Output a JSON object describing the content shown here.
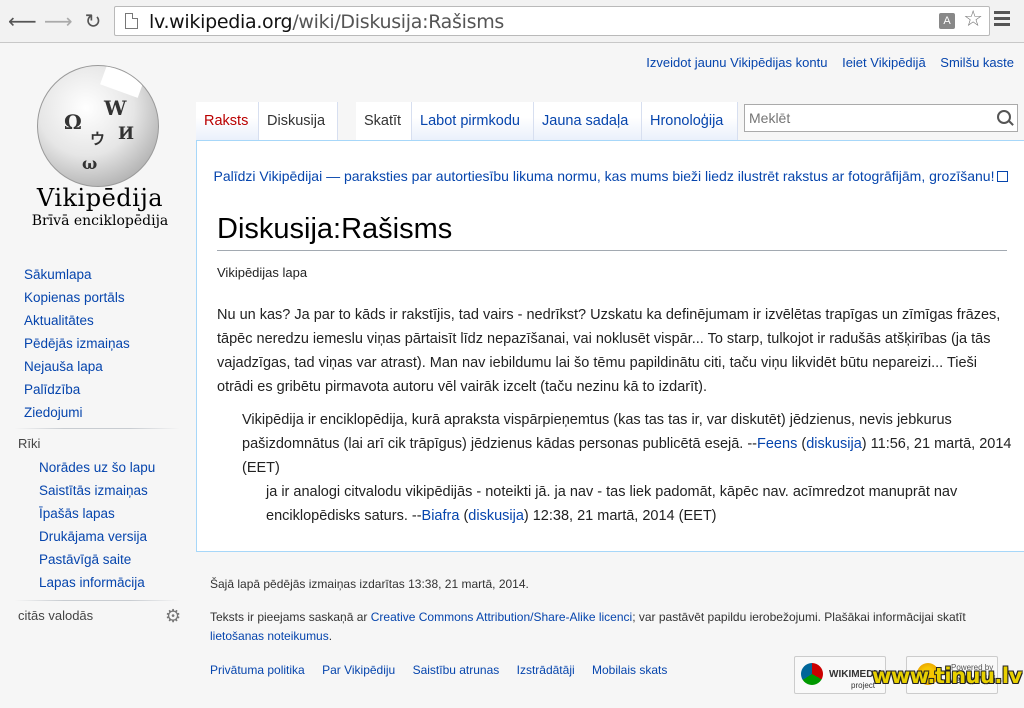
{
  "browser": {
    "url_host": "lv.wikipedia.org",
    "url_path": "/wiki/Diskusija:Rašisms",
    "icons": [
      "back-arrow-icon",
      "forward-arrow-icon",
      "reload-icon",
      "page-icon",
      "translate-icon",
      "star-icon",
      "menu-icon"
    ]
  },
  "logo": {
    "wordmark": "Vikipēdija",
    "tagline": "Brīvā enciklopēdija",
    "glyphs": [
      "Ω",
      "W",
      "И",
      "ウ",
      "ω"
    ]
  },
  "sidebar": {
    "nav": [
      "Sākumlapa",
      "Kopienas portāls",
      "Aktualitātes",
      "Pēdējās izmaiņas",
      "Nejauša lapa",
      "Palīdzība",
      "Ziedojumi"
    ],
    "tools_heading": "Rīki",
    "tools": [
      "Norādes uz šo lapu",
      "Saistītās izmaiņas",
      "Īpašās lapas",
      "Drukājama versija",
      "Pastāvīgā saite",
      "Lapas informācija"
    ],
    "languages_heading": "citās valodās"
  },
  "personal": [
    "Izveidot jaunu Vikipēdijas kontu",
    "Ieiet Vikipēdijā",
    "Smilšu kaste"
  ],
  "tabs": {
    "article": "Raksts",
    "talk": "Diskusija",
    "view": "Skatīt",
    "edit": "Labot pirmkodu",
    "new_section": "Jauna sadaļa",
    "history": "Hronoloģija"
  },
  "search": {
    "placeholder": "Meklēt"
  },
  "content": {
    "site_notice": "Palīdzi Vikipēdijai — paraksties par autortiesību likuma normu, kas mums bieži liedz ilustrēt rakstus ar fotogrāfijām, grozīšanu!",
    "title": "Diskusija:Rašisms",
    "site_sub": "Vikipēdijas lapa",
    "p1": "Nu un kas? Ja par to kāds ir rakstījis, tad vairs - nedrīkst? Uzskatu ka definējumam ir izvēlētas trapīgas un zīmīgas frāzes, tāpēc neredzu iemeslu viņas pārtaisīt līdz nepazīšanai, vai noklusēt vispār... To starp, tulkojot ir radušās atšķirības (ja tās vajadzīgas, tad viņas var atrast). Man nav iebildumu lai šo tēmu papildinātu citi, taču viņu likvidēt būtu nepareizi... Tieši otrādi es gribētu pirmavota autoru vēl vairāk izcelt (taču nezinu kā to izdarīt).",
    "p2": {
      "text": "Vikipēdija ir enciklopēdija, kurā apraksta vispārpieņemtus (kas tas tas ir, var diskutēt) jēdzienus, nevis jebkurus pašizdomnātus (lai arī cik trāpīgus) jēdzienus kādas personas publicētā esejā. --",
      "user": "Feens",
      "open": " (",
      "talk": "diskusija",
      "close": ") 11:56, 21 martā, 2014 (EET)"
    },
    "p3": {
      "text": "ja ir analogi citvalodu vikipēdijās - noteikti jā. ja nav - tas liek padomāt, kāpēc nav. acīmredzot manuprāt nav enciklopēdisks saturs. --",
      "user": "Biafra",
      "open": " (",
      "talk": "diskusija",
      "close": ") 12:38, 21 martā, 2014 (EET)"
    }
  },
  "footer": {
    "last_modified": "Šajā lapā pēdējās izmaiņas izdarītas 13:38, 21 martā, 2014.",
    "license_pre": "Teksts ir pieejams saskaņā ar ",
    "license_link": "Creative Commons Attribution/Share-Alike licenci",
    "license_mid": "; var pastāvēt papildu ierobežojumi. Plašākai informācijai skatīt ",
    "terms_link": "lietošanas noteikumus",
    "license_end": ".",
    "links": [
      "Privātuma politika",
      "Par Vikipēdiju",
      "Saistību atrunas",
      "Izstrādātāji",
      "Mobilais skats"
    ],
    "badge_wikimedia": "WIKIMEDIA",
    "badge_wikimedia_sub": "project",
    "badge_mediawiki_top": "Powered by",
    "badge_mediawiki": "MediaWiki",
    "watermark": "www.tinuu.lv"
  }
}
